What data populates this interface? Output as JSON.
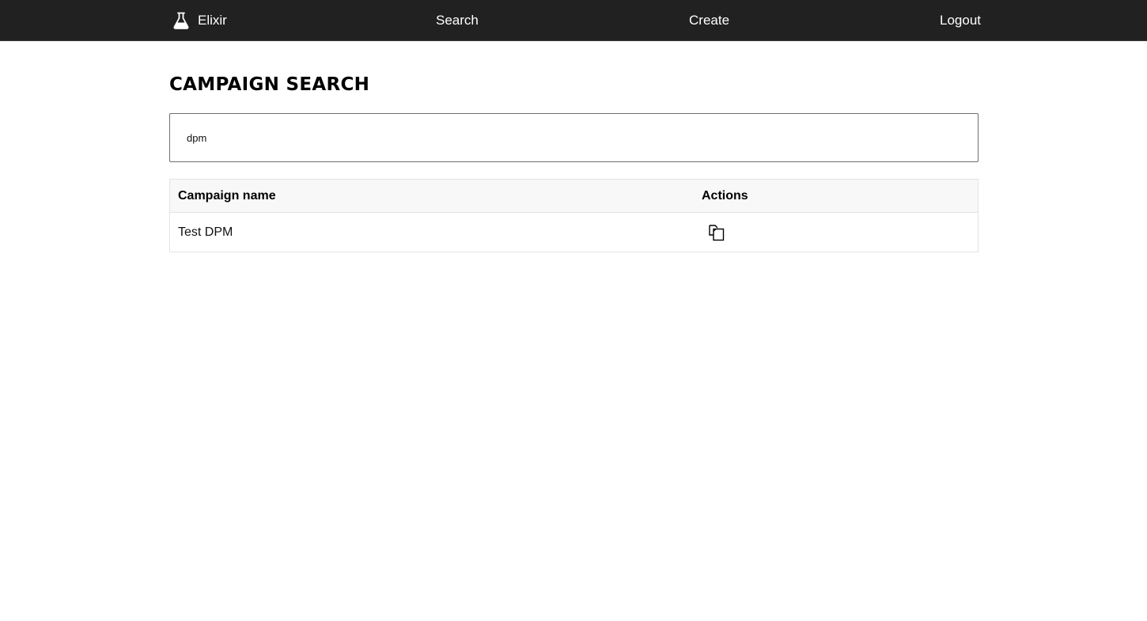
{
  "nav": {
    "brand": "Elixir",
    "brand_icon": "flask-icon",
    "links": {
      "search": "Search",
      "create": "Create",
      "logout": "Logout"
    }
  },
  "page": {
    "title": "CAMPAIGN SEARCH"
  },
  "search": {
    "value": "dpm",
    "placeholder": ""
  },
  "table": {
    "columns": [
      "Campaign name",
      "Actions"
    ],
    "rows": [
      {
        "name": "Test DPM",
        "action_icon": "copy-icon"
      }
    ]
  },
  "colors": {
    "navbar": "#212121",
    "background": "#ffffff",
    "table_header": "#f8f8f8"
  }
}
